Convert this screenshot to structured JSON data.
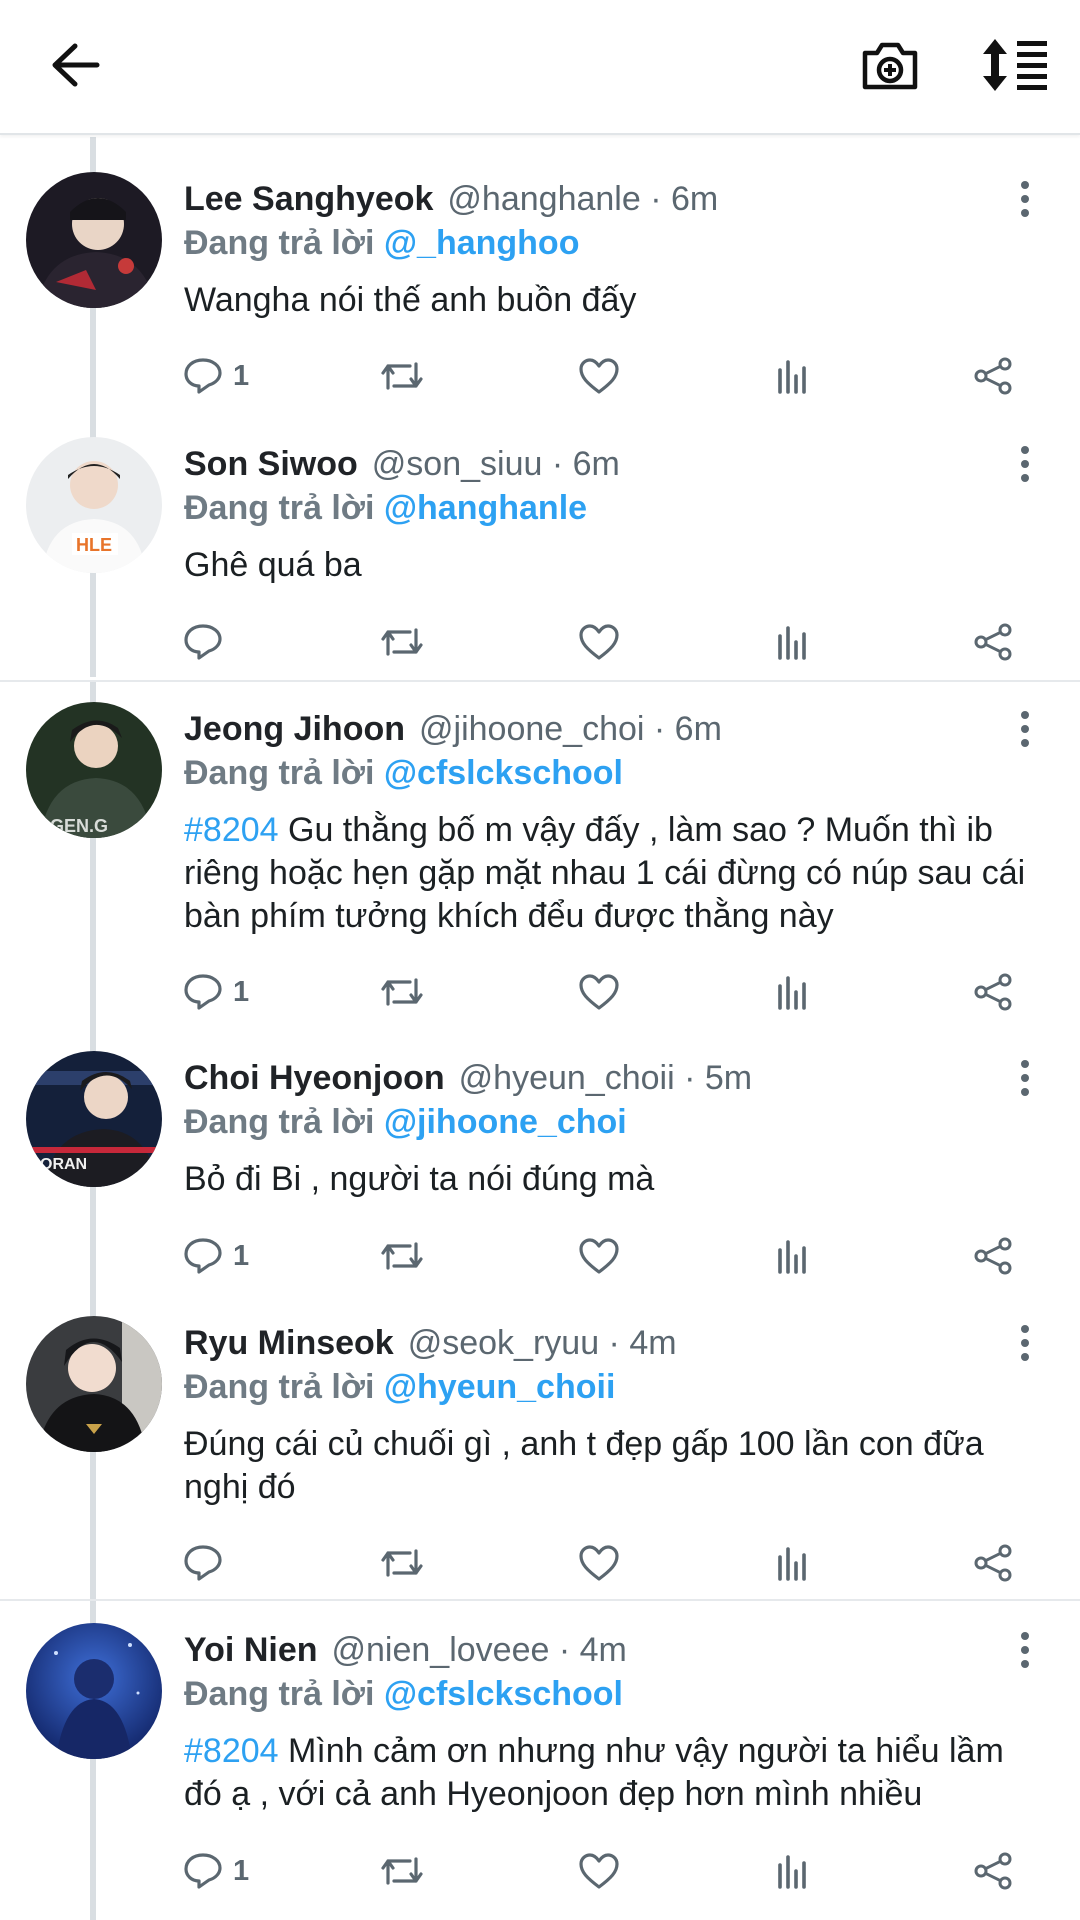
{
  "topbar": {
    "back_icon": "back-arrow-icon",
    "camera_icon": "camera-plus-icon",
    "sort_icon": "sort-list-icon"
  },
  "colors": {
    "link": "#2da1f2",
    "muted": "#5b6770",
    "thread_line": "#d9dee2"
  },
  "reply_prefix": "Đang trả lời",
  "tweets": [
    {
      "name": "Lee Sanghyeok",
      "handle_time": "@hanghanle · 6m",
      "reply_to": "@_hanghoo",
      "tag": "",
      "text": "Wangha nói thế anh buồn đấy",
      "reply_count": "1"
    },
    {
      "name": "Son Siwoo",
      "handle_time": "@son_siuu · 6m",
      "reply_to": "@hanghanle",
      "tag": "",
      "text": "Ghê quá ba",
      "reply_count": ""
    },
    {
      "name": "Jeong Jihoon",
      "handle_time": "@jihoone_choi · 6m",
      "reply_to": "@cfslckschool",
      "tag": "#8204",
      "text": " Gu thằng bố m vậy đấy , làm sao ? Muốn thì ib riêng hoặc hẹn gặp mặt nhau 1 cái đừng có núp sau cái bàn phím tưởng khích đểu được thằng này",
      "reply_count": "1"
    },
    {
      "name": "Choi Hyeonjoon",
      "handle_time": "@hyeun_choii · 5m",
      "reply_to": "@jihoone_choi",
      "tag": "",
      "text": "Bỏ đi Bi , người ta nói đúng mà",
      "reply_count": "1"
    },
    {
      "name": "Ryu Minseok",
      "handle_time": "@seok_ryuu · 4m",
      "reply_to": "@hyeun_choii",
      "tag": "",
      "text": "Đúng cái củ chuối gì , anh t đẹp gấp 100 lần con đữa nghị đó",
      "reply_count": ""
    },
    {
      "name": "Yoi Nien",
      "handle_time": "@nien_loveee · 4m",
      "reply_to": "@cfslckschool",
      "tag": "#8204",
      "text": " Mình cảm ơn nhưng như vậy người ta hiểu lầm đó ạ , với cả anh Hyeonjoon đẹp hơn mình nhiều",
      "reply_count": "1"
    }
  ]
}
